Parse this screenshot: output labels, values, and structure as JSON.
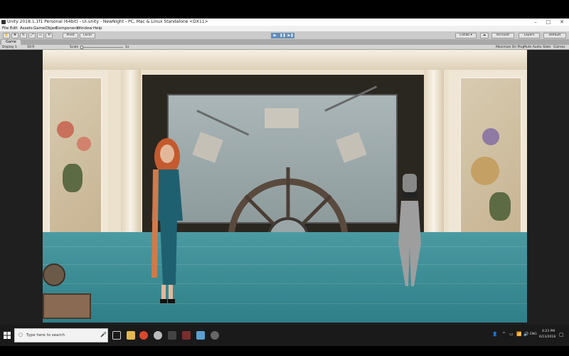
{
  "window": {
    "title": "Unity 2018.1.1f1 Personal (64bit) - Ui.unity - NewNight - PC, Mac & Linux Standalone <DX11>",
    "controls": {
      "minimize": "–",
      "maximize": "□",
      "close": "✕"
    }
  },
  "menu": [
    "File",
    "Edit",
    "Assets",
    "GameObject",
    "Component",
    "Window",
    "Help"
  ],
  "toolbar": {
    "pivot_label": "Pivot",
    "local_label": "Local",
    "play": "▶",
    "pause": "❚❚",
    "step": "▶❚",
    "collab_label": "Collab ▾",
    "account_label": "Account",
    "layers_label": "Layers",
    "layout_label": "Default"
  },
  "game_tab": {
    "tab_label": "Game",
    "display_label": "Display 1",
    "aspect_label": "16:9",
    "scale_label": "Scale",
    "scale_value": "1x",
    "maximize_label": "Maximize On Play",
    "mute_label": "Mute Audio",
    "stats_label": "Stats",
    "gizmos_label": "Gizmos"
  },
  "taskbar": {
    "search_placeholder": "Type here to search",
    "language": "ENG",
    "time": "4:23 PM",
    "date": "6/13/2018"
  },
  "colors": {
    "play_active": "#5b8cc4",
    "floor": "#3e8f98",
    "taskbar": "#1a1a1a"
  }
}
